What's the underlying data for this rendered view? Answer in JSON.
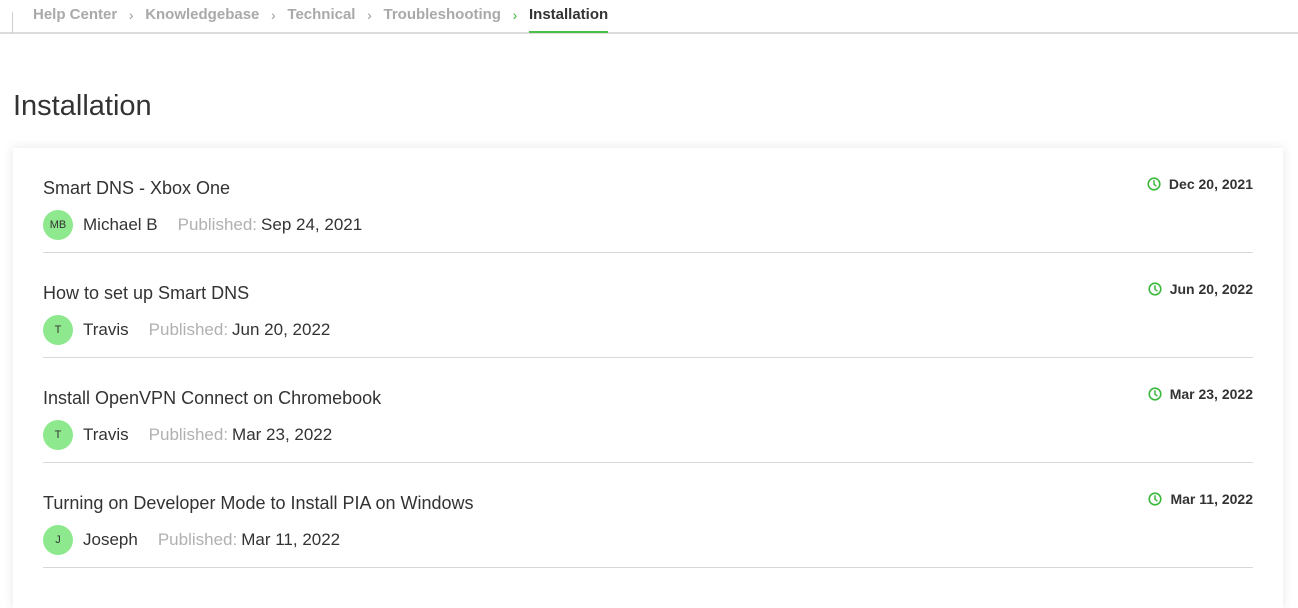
{
  "breadcrumb": {
    "items": [
      {
        "label": "Help Center"
      },
      {
        "label": "Knowledgebase"
      },
      {
        "label": "Technical"
      },
      {
        "label": "Troubleshooting"
      },
      {
        "label": "Installation"
      }
    ],
    "separator": "›"
  },
  "page": {
    "title": "Installation"
  },
  "articles": [
    {
      "title": "Smart DNS - Xbox One",
      "avatar_initials": "MB",
      "author": "Michael B",
      "published_label": "Published:",
      "published_date": "Sep 24, 2021",
      "updated_date": "Dec 20, 2021"
    },
    {
      "title": "How to set up Smart DNS",
      "avatar_initials": "T",
      "author": "Travis",
      "published_label": "Published:",
      "published_date": "Jun 20, 2022",
      "updated_date": "Jun 20, 2022"
    },
    {
      "title": "Install OpenVPN Connect on Chromebook",
      "avatar_initials": "T",
      "author": "Travis",
      "published_label": "Published:",
      "published_date": "Mar 23, 2022",
      "updated_date": "Mar 23, 2022"
    },
    {
      "title": "Turning on Developer Mode to Install PIA on Windows",
      "avatar_initials": "J",
      "author": "Joseph",
      "published_label": "Published:",
      "published_date": "Mar 11, 2022",
      "updated_date": "Mar 11, 2022"
    }
  ],
  "colors": {
    "accent": "#3cb83c",
    "avatar_bg": "#8ee98e"
  }
}
